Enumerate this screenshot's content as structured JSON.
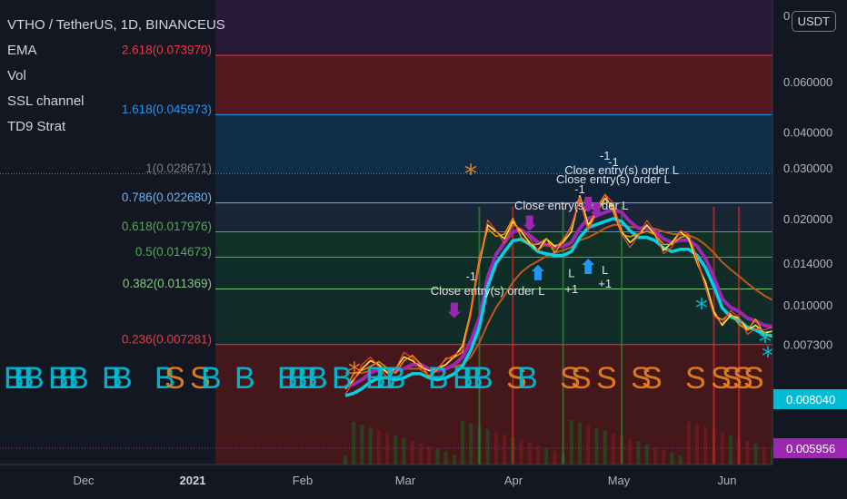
{
  "header": {
    "title": "VTHO / TetherUS, 1D, BINANCEUS",
    "indicators": [
      "EMA",
      "Vol",
      "SSL channel",
      "TD9 Strat"
    ]
  },
  "currency_button": "USDT",
  "chart_data": {
    "type": "line",
    "title": "VTHO / TetherUS, 1D, BINANCEUS",
    "y_scale": "log",
    "y_ticks": [
      "0.060000",
      "0.040000",
      "0.030000",
      "0.020000",
      "0.014000",
      "0.010000",
      "0.007300",
      "0.005956"
    ],
    "y_top_partial": "0",
    "x_ticks": [
      "Dec",
      "2021",
      "Feb",
      "Mar",
      "Apr",
      "May",
      "Jun"
    ],
    "price_labels": [
      {
        "value": "0.008040",
        "color": "#00bcd4"
      },
      {
        "value": "0.005956",
        "color": "#9c27b0"
      }
    ],
    "fib_levels": [
      {
        "label": "2.618(0.073970)",
        "value": 0.07397,
        "color": "#f23645",
        "zone": "#5c1a1f"
      },
      {
        "label": "1.618(0.045973)",
        "value": 0.045973,
        "color": "#2196f3",
        "zone": "#10314e"
      },
      {
        "label": "1(0.028671)",
        "value": 0.028671,
        "color": "#787b86",
        "zone": "#0f2437"
      },
      {
        "label": "0.786(0.022680)",
        "value": 0.02268,
        "color": "#64b5f6",
        "zone": "#1b2838"
      },
      {
        "label": "0.618(0.017976)",
        "value": 0.017976,
        "color": "#4caf50",
        "zone": "#123428"
      },
      {
        "label": "0.5(0.014673)",
        "value": 0.014673,
        "color": "#4caf50",
        "zone": "#0e3028"
      },
      {
        "label": "0.382(0.011369)",
        "value": 0.011369,
        "color": "#81c784",
        "zone": "#13302a"
      },
      {
        "label": "0.236(0.007281)",
        "value": 0.007281,
        "color": "#f23645",
        "zone": "#4a1719"
      }
    ],
    "price_close": [
      0.0051,
      0.0055,
      0.006,
      0.0064,
      0.0062,
      0.0058,
      0.006,
      0.0066,
      0.0064,
      0.0061,
      0.0059,
      0.006,
      0.0062,
      0.0066,
      0.0072,
      0.0095,
      0.014,
      0.019,
      0.018,
      0.017,
      0.0195,
      0.018,
      0.0165,
      0.0155,
      0.017,
      0.016,
      0.0165,
      0.018,
      0.024,
      0.019,
      0.021,
      0.0235,
      0.022,
      0.018,
      0.0165,
      0.0175,
      0.019,
      0.0175,
      0.0155,
      0.0165,
      0.018,
      0.017,
      0.014,
      0.012,
      0.0095,
      0.0085,
      0.0092,
      0.009,
      0.0082,
      0.0085,
      0.008,
      0.0081
    ],
    "ssl_line": [
      0.0052,
      0.0053,
      0.0055,
      0.0058,
      0.006,
      0.006,
      0.0059,
      0.006,
      0.0062,
      0.0062,
      0.006,
      0.0059,
      0.006,
      0.0062,
      0.0066,
      0.0075,
      0.009,
      0.0125,
      0.015,
      0.0165,
      0.018,
      0.0182,
      0.0175,
      0.0165,
      0.0162,
      0.016,
      0.016,
      0.0165,
      0.0185,
      0.02,
      0.0205,
      0.021,
      0.0215,
      0.021,
      0.0195,
      0.0185,
      0.0185,
      0.018,
      0.017,
      0.0165,
      0.0168,
      0.0168,
      0.016,
      0.0145,
      0.0125,
      0.0105,
      0.0098,
      0.0095,
      0.009,
      0.0088,
      0.0085,
      0.0084
    ],
    "ema_line": [
      0.0058,
      0.0058,
      0.0058,
      0.0059,
      0.0059,
      0.0059,
      0.0059,
      0.006,
      0.006,
      0.006,
      0.006,
      0.006,
      0.006,
      0.0061,
      0.0062,
      0.0066,
      0.0074,
      0.0086,
      0.0098,
      0.0108,
      0.012,
      0.013,
      0.0137,
      0.0142,
      0.0148,
      0.0152,
      0.0155,
      0.0159,
      0.0168,
      0.0172,
      0.0178,
      0.0185,
      0.019,
      0.019,
      0.0187,
      0.0186,
      0.0186,
      0.0184,
      0.018,
      0.0177,
      0.0176,
      0.0175,
      0.017,
      0.0162,
      0.0152,
      0.0141,
      0.0133,
      0.0126,
      0.0119,
      0.0113,
      0.0108,
      0.0104
    ],
    "annotations": [
      {
        "text": "Close entry(s) order L",
        "x_index": 17,
        "price": 0.01085
      },
      {
        "text": "Close entry(s) order L",
        "x_index": 27,
        "price": 0.0215
      },
      {
        "text": "Close entry(s) order L",
        "x_index": 32,
        "price": 0.0265
      },
      {
        "text": "Close entry(s) order L",
        "x_index": 33,
        "price": 0.0285
      },
      {
        "text": "-1",
        "x_index": 15,
        "price": 0.0122
      },
      {
        "text": "-1",
        "x_index": 28,
        "price": 0.0245
      },
      {
        "text": "-1",
        "x_index": 31,
        "price": 0.032
      },
      {
        "text": "-1",
        "x_index": 32,
        "price": 0.0305
      },
      {
        "text": "+1",
        "x_index": 27,
        "price": 0.011
      },
      {
        "text": "+1",
        "x_index": 31,
        "price": 0.0115
      },
      {
        "text": "L",
        "x_index": 27,
        "price": 0.0125
      },
      {
        "text": "L",
        "x_index": 31,
        "price": 0.0128
      }
    ],
    "bottom_letters": "BBB BBB BB BS SB B BBBB B BBB B BBB SB SS S SS S SSSS"
  }
}
